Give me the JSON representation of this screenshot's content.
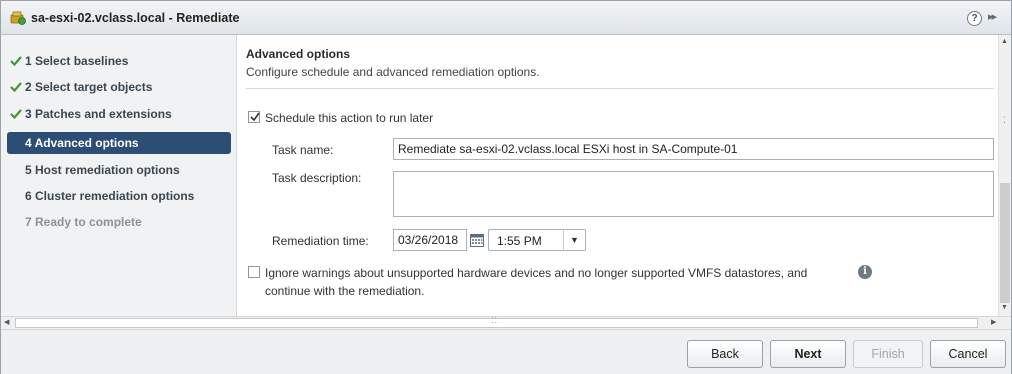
{
  "window": {
    "title": "sa-esxi-02.vclass.local - Remediate",
    "help_glyph": "?",
    "expand_glyph": "▸▸"
  },
  "nav": {
    "items": [
      {
        "label": "1  Select baselines",
        "state": "completed"
      },
      {
        "label": "2  Select target objects",
        "state": "completed"
      },
      {
        "label": "3  Patches and extensions",
        "state": "completed"
      },
      {
        "label": "4  Advanced options",
        "state": "active"
      },
      {
        "label": "5  Host remediation options",
        "state": "pending"
      },
      {
        "label": "6  Cluster remediation options",
        "state": "pending"
      },
      {
        "label": "7  Ready to complete",
        "state": "disabled"
      }
    ]
  },
  "content": {
    "heading": "Advanced options",
    "subheading": "Configure schedule and advanced remediation options.",
    "schedule": {
      "checked": true,
      "label": "Schedule this action to run later"
    },
    "task_name": {
      "label": "Task name:",
      "value": "Remediate sa-esxi-02.vclass.local ESXi host in SA-Compute-01"
    },
    "task_description": {
      "label": "Task description:",
      "value": ""
    },
    "remediation_time": {
      "label": "Remediation time:",
      "date": "03/26/2018",
      "time": "1:55 PM"
    },
    "ignore_warnings": {
      "checked": false,
      "label_line1": "Ignore warnings about unsupported hardware devices and no longer supported VMFS datastores, and",
      "label_line2": "continue with the remediation.",
      "info_glyph": "i"
    }
  },
  "footer": {
    "back": "Back",
    "next": "Next",
    "finish": "Finish",
    "cancel": "Cancel"
  },
  "colors": {
    "active_nav": "#2c4e74",
    "check_green": "#3c9a2e"
  }
}
